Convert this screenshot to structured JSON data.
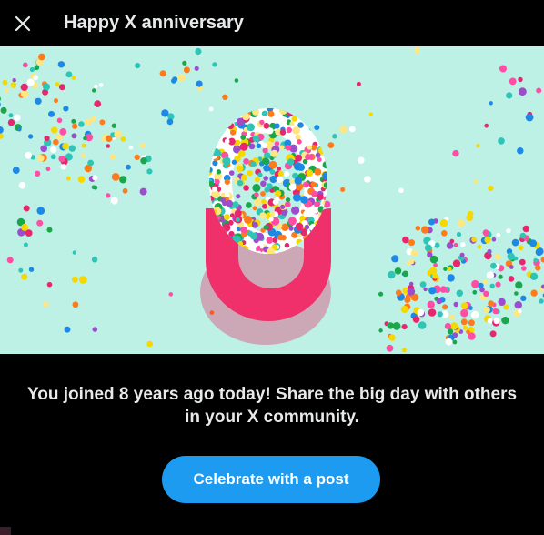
{
  "header": {
    "close_icon": "close-icon",
    "title": "Happy X anniversary"
  },
  "hero": {
    "image": "number-8-made-of-confetti-and-pink-paper",
    "colors": {
      "background": "#bdf1e6",
      "ring_pink": "#f0306a"
    }
  },
  "body": {
    "message": "You joined 8 years ago today! Share the big day with others in your X community."
  },
  "cta": {
    "label": "Celebrate with a post",
    "color": "#1d9bf0"
  }
}
